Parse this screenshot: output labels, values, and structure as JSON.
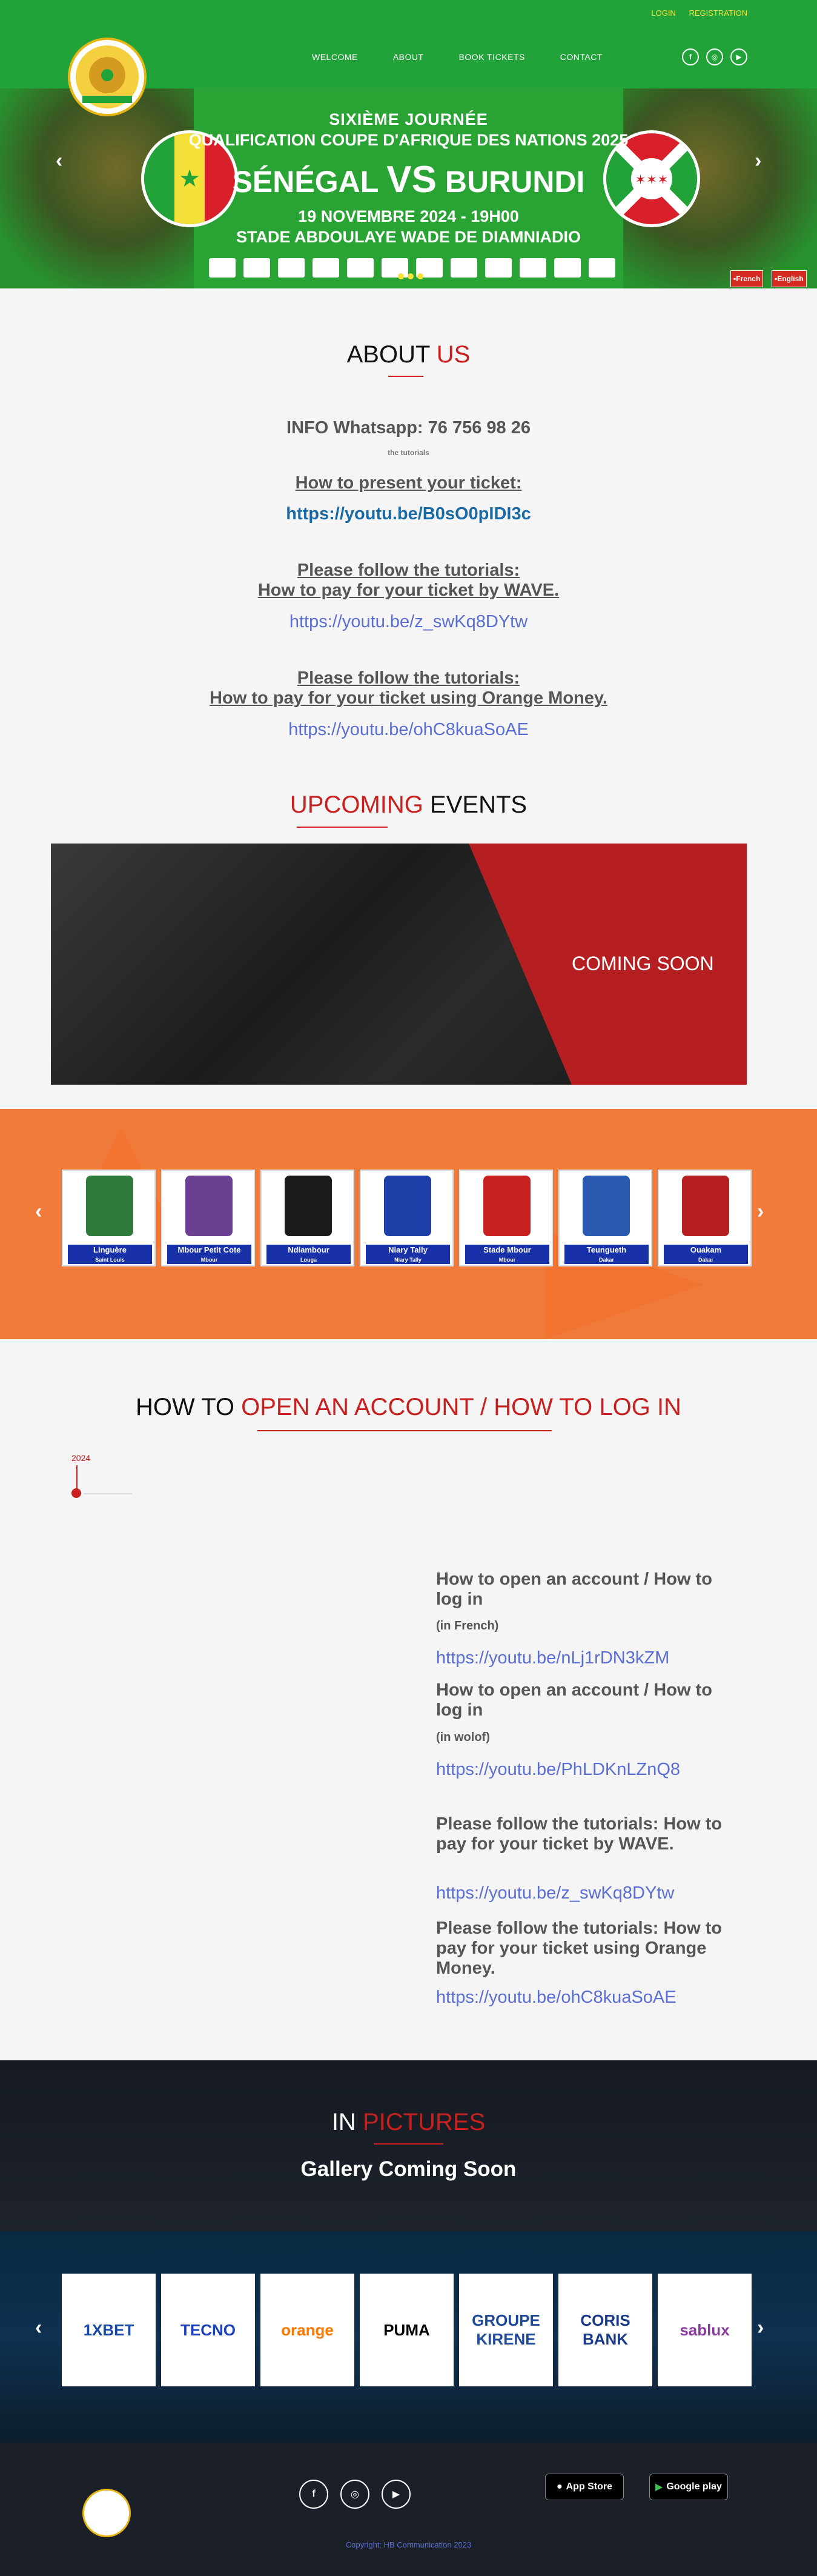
{
  "header": {
    "login": "LOGIN",
    "registration": "REGISTRATION",
    "nav": [
      "WELCOME",
      "ABOUT",
      "BOOK TICKETS",
      "CONTACT"
    ],
    "social": [
      "f",
      "◎",
      "▶"
    ]
  },
  "hero": {
    "line1": "SIXIÈME JOURNÉE",
    "line2": "QUALIFICATION COUPE D'AFRIQUE DES NATIONS 2025",
    "team1": "SÉNÉGAL",
    "vs": "VS",
    "team2": "BURUNDI",
    "datetime": "19 NOVEMBRE 2024 - 19H00",
    "venue": "STADE ABDOULAYE WADE DE DIAMNIADIO",
    "lang_fr": "French",
    "lang_en": "English"
  },
  "about": {
    "title_a": "ABOUT ",
    "title_b": "US",
    "info": "INFO Whatsapp: 76 756 98 26",
    "small": "the tutorials",
    "h1": "How to present your ticket:",
    "link1": "https://youtu.be/B0sO0pIDI3c",
    "h2a": "Please follow the tutorials:",
    "h2b": "How to pay for your ticket by WAVE.",
    "link2": "https://youtu.be/z_swKq8DYtw",
    "h3a": "Please follow the tutorials:",
    "h3b": "How to pay for your ticket using Orange Money.",
    "link3": "https://youtu.be/ohC8kuaSoAE"
  },
  "upcoming": {
    "title_a": "UPCOMING",
    "title_b": " EVENTS",
    "coming_soon": "COMING SOON"
  },
  "clubs": [
    {
      "name": "Linguère",
      "city": "Saint Louis",
      "color": "#2e7b3c"
    },
    {
      "name": "Mbour Petit Cote",
      "city": "Mbour",
      "color": "#6b3f92"
    },
    {
      "name": "Ndiambour",
      "city": "Louga",
      "color": "#1a1a1a"
    },
    {
      "name": "Niary Tally",
      "city": "Niary Tally",
      "color": "#1f3fa8"
    },
    {
      "name": "Stade Mbour",
      "city": "Mbour",
      "color": "#c8201e"
    },
    {
      "name": "Teungueth",
      "city": "Dakar",
      "color": "#2a5bb0"
    },
    {
      "name": "Ouakam",
      "city": "Dakar",
      "color": "#b51f21"
    }
  ],
  "howto": {
    "title_a": "HOW TO ",
    "title_b": "OPEN AN ACCOUNT / HOW TO LOG IN",
    "year": "2024",
    "t1": "How to open an account / How to log in",
    "s1": "(in French)",
    "l1": "https://youtu.be/nLj1rDN3kZM",
    "t2": "How to open an account / How to log in",
    "s2": "(in wolof)",
    "l2": "https://youtu.be/PhLDKnLZnQ8",
    "t3": "Please follow the tutorials: How to pay for your ticket by WAVE.",
    "l3": "https://youtu.be/z_swKq8DYtw",
    "t4": "Please follow the tutorials: How to pay for your ticket using Orange Money.",
    "l4": "https://youtu.be/ohC8kuaSoAE"
  },
  "pictures": {
    "title_a": "IN ",
    "title_b": "PICTURES",
    "sub": "Gallery Coming Soon"
  },
  "partners": [
    {
      "name": "1XBET",
      "color": "#1a4aa8"
    },
    {
      "name": "TECNO",
      "color": "#1a3fb8"
    },
    {
      "name": "orange",
      "color": "#ff7900"
    },
    {
      "name": "PUMA",
      "color": "#000000"
    },
    {
      "name": "GROUPE KIRENE",
      "color": "#1f4a9a"
    },
    {
      "name": "CORIS BANK",
      "color": "#1a3a8a"
    },
    {
      "name": "sablux",
      "color": "#8a3fa0"
    }
  ],
  "footer": {
    "appstore": "App Store",
    "googleplay": "Google play",
    "copyright": "Copyright: HB Communication 2023"
  },
  "colors": {
    "green": "#21a33a",
    "red": "#c8201e",
    "orange": "#f07a3a",
    "link": "#5a6ed3"
  }
}
